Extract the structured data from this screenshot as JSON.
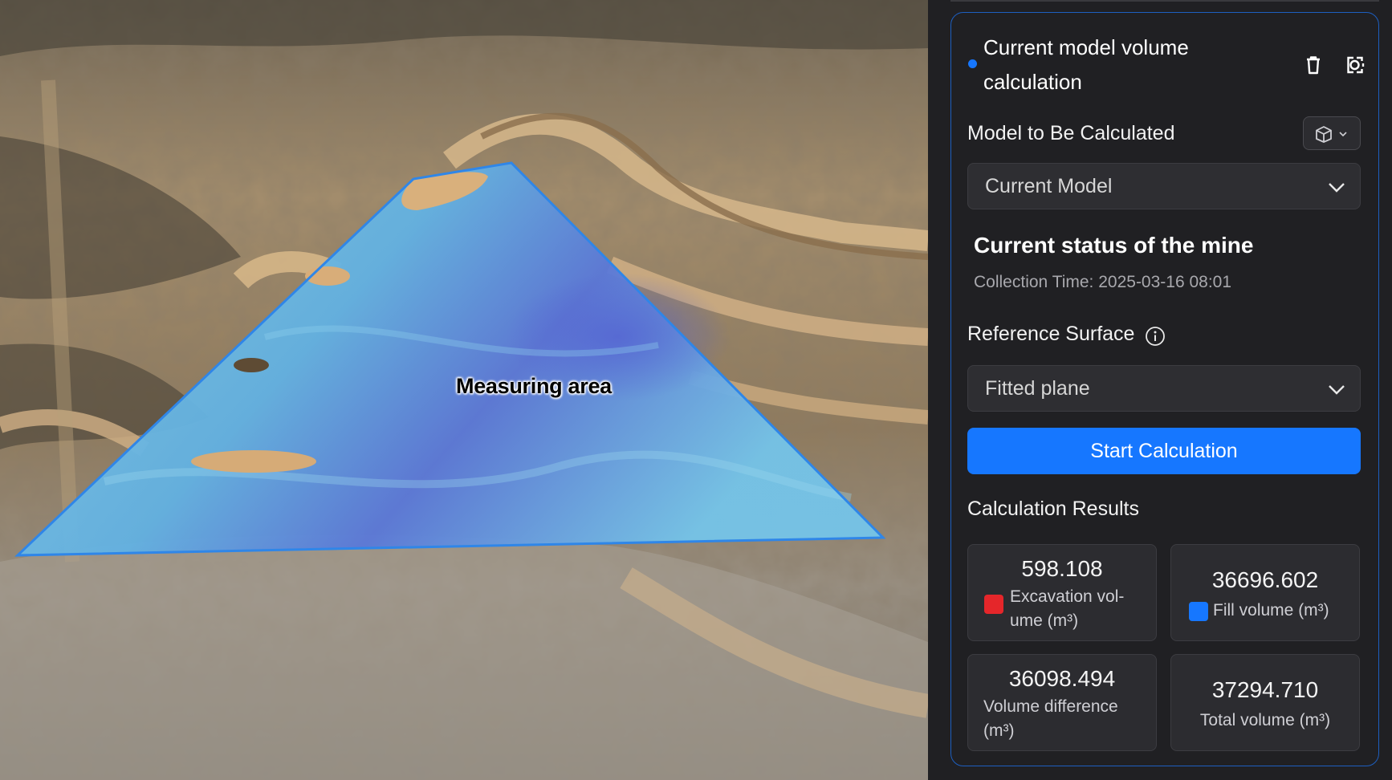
{
  "viewport": {
    "measure_label": "Measuring area"
  },
  "panel": {
    "card_title": "Current model volume calculation",
    "icons": {
      "delete": "trash-icon",
      "locate": "target-camera-icon",
      "model_switch": "cube-icon"
    },
    "model_label": "Model to Be Calculated",
    "model_select_value": "Current Model",
    "mine_title": "Current status of the mine",
    "collection_time": "Collection Time: 2025-03-16 08:01",
    "reference_label": "Reference Surface",
    "reference_select_value": "Fitted plane",
    "start_button": "Start Calculation",
    "results_title": "Calculation Results",
    "results": {
      "excavation": {
        "value": "598.108",
        "label_line1": "Excavation vol-",
        "label_line2": "ume (m³)",
        "color": "#e5262a"
      },
      "fill": {
        "value": "36696.602",
        "label": "Fill volume (m³)",
        "color": "#1677ff"
      },
      "difference": {
        "value": "36098.494",
        "label_line1": "Volume difference",
        "label_line2": "(m³)"
      },
      "total": {
        "value": "37294.710",
        "label": "Total volume (m³)"
      }
    },
    "accent_color": "#1677ff"
  }
}
